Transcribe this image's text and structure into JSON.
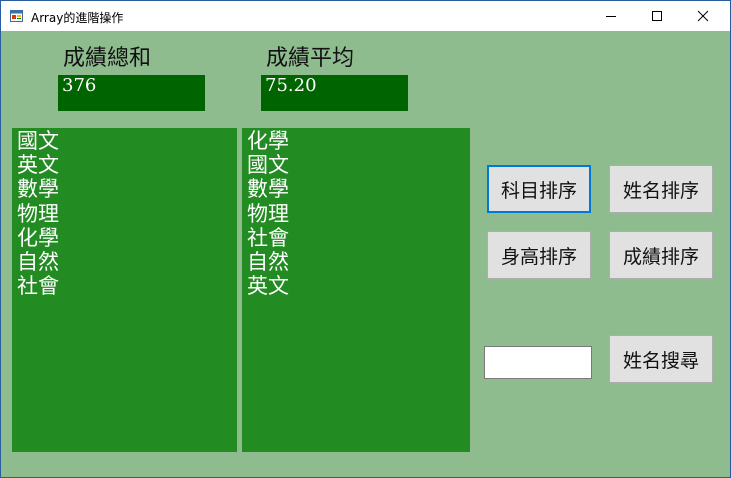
{
  "window": {
    "title": "Array的進階操作",
    "controls": {
      "minimize": "—",
      "maximize": "☐",
      "close": "✕"
    },
    "app_icon": "form-icon"
  },
  "sum": {
    "label": "成績總和",
    "value": "376"
  },
  "average": {
    "label": "成績平均",
    "value": "75.20"
  },
  "list_left": {
    "items": [
      "國文",
      "英文",
      "數學",
      "物理",
      "化學",
      "自然",
      "社會"
    ]
  },
  "list_right": {
    "items": [
      "化學",
      "國文",
      "數學",
      "物理",
      "社會",
      "自然",
      "英文"
    ]
  },
  "buttons": {
    "subject_sort": "科目排序",
    "name_sort": "姓名排序",
    "height_sort": "身高排序",
    "score_sort": "成績排序",
    "name_search": "姓名搜尋"
  },
  "search": {
    "value": ""
  },
  "colors": {
    "client_bg": "#8fbc8f",
    "value_box": "#006400",
    "list_bg": "#228b22",
    "focus_border": "#0078d7"
  }
}
